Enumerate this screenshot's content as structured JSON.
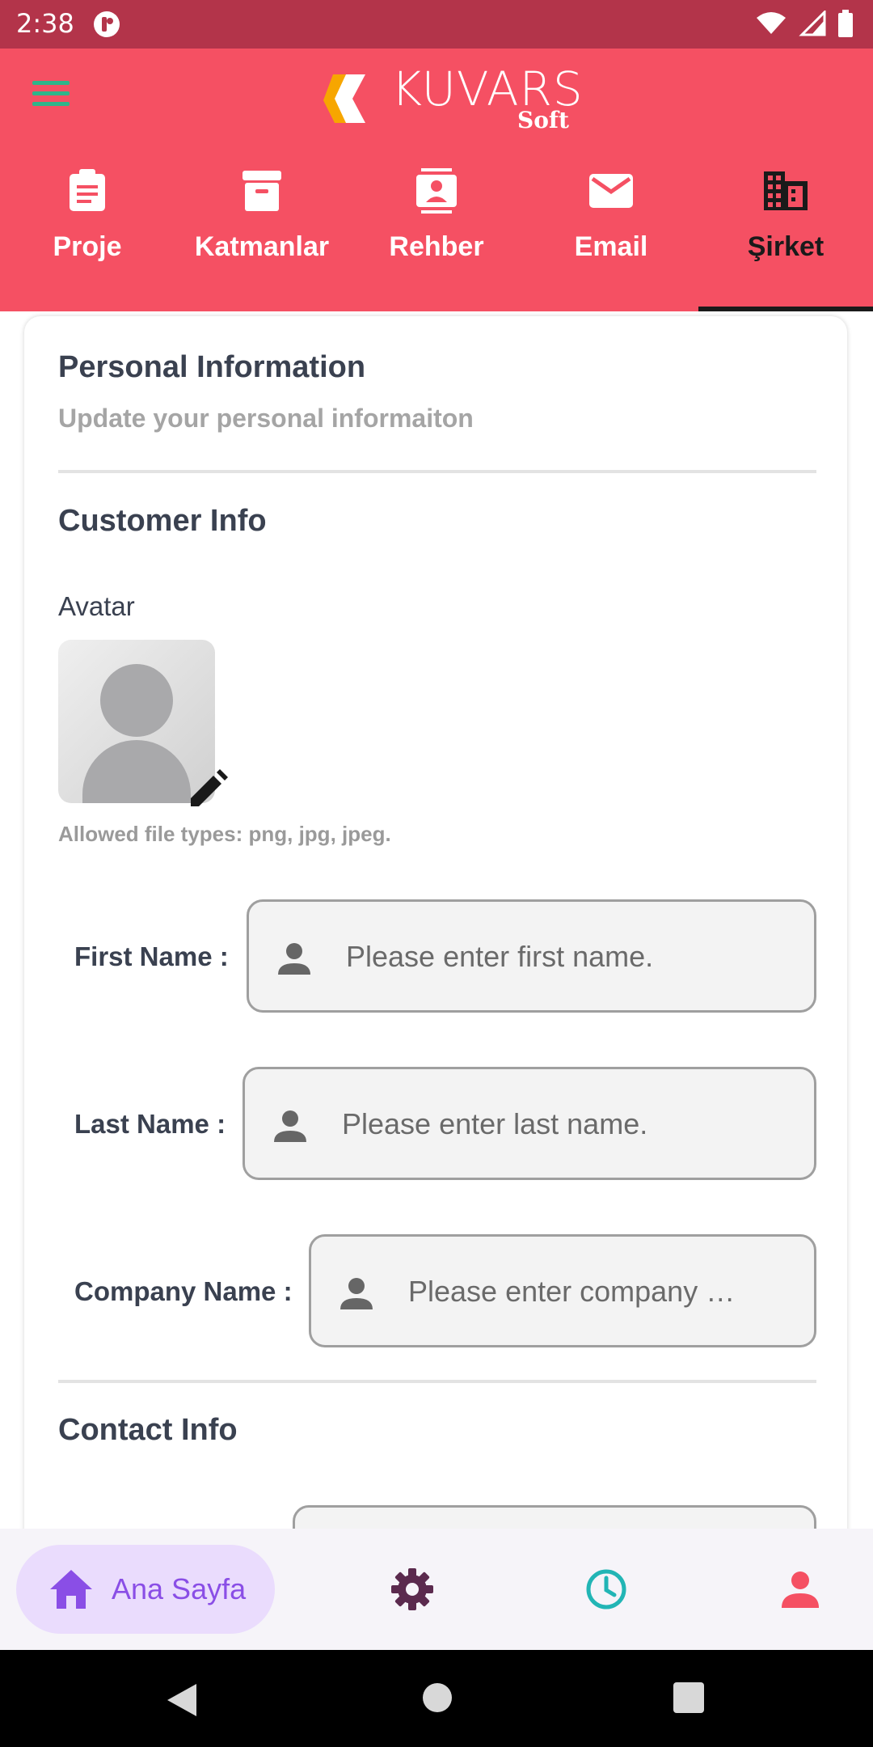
{
  "status": {
    "time": "2:38"
  },
  "header": {
    "logo_text": "KUVARS",
    "logo_sub": "Soft",
    "tabs": [
      {
        "label": "Proje",
        "icon": "clipboard-icon"
      },
      {
        "label": "Katmanlar",
        "icon": "archive-icon"
      },
      {
        "label": "Rehber",
        "icon": "contacts-icon"
      },
      {
        "label": "Email",
        "icon": "mail-icon"
      },
      {
        "label": "Şirket",
        "icon": "building-icon",
        "active": true
      }
    ]
  },
  "card": {
    "title": "Personal Information",
    "subtitle": "Update your personal informaiton",
    "customer_section": "Customer Info",
    "avatar_label": "Avatar",
    "file_hint": "Allowed file types: png, jpg, jpeg.",
    "fields": {
      "first_name": {
        "label": "First Name :",
        "placeholder": "Please enter first name."
      },
      "last_name": {
        "label": "Last Name :",
        "placeholder": "Please enter last name."
      },
      "company_name": {
        "label": "Company Name :",
        "placeholder": "Please enter company …"
      }
    },
    "contact_section": "Contact Info"
  },
  "bottom_nav": {
    "home_label": "Ana Sayfa",
    "items": [
      "home-icon",
      "settings-icon",
      "history-icon",
      "profile-icon"
    ]
  },
  "colors": {
    "header": "#f55063",
    "statusbar": "#b3344a",
    "home_pill": "#eadcfd",
    "home_accent": "#8a4ee6",
    "settings": "#5b2a4e",
    "history": "#22b5b5",
    "profile": "#f55063"
  }
}
